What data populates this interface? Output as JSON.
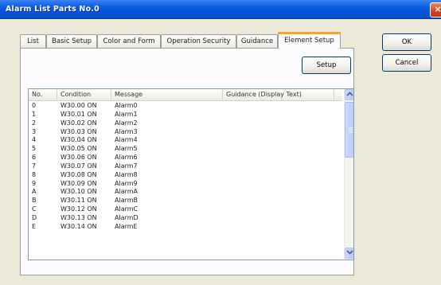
{
  "window": {
    "title": "Alarm List Parts No.0",
    "close_label": "×"
  },
  "tabs": [
    {
      "label": "List",
      "active": false
    },
    {
      "label": "Basic Setup",
      "active": false
    },
    {
      "label": "Color and Form",
      "active": false
    },
    {
      "label": "Operation Security",
      "active": false
    },
    {
      "label": "Guidance",
      "active": false
    },
    {
      "label": "Element Setup",
      "active": true
    }
  ],
  "buttons": {
    "setup_label": "Setup",
    "ok_label": "OK",
    "cancel_label": "Cancel"
  },
  "list": {
    "columns": [
      "No.",
      "Condition",
      "Message",
      "Guidance (Display Text)"
    ],
    "rows": [
      {
        "no": "0",
        "condition": "W30.00 ON",
        "message": "Alarm0",
        "guidance": ""
      },
      {
        "no": "1",
        "condition": "W30.01 ON",
        "message": "Alarm1",
        "guidance": ""
      },
      {
        "no": "2",
        "condition": "W30.02 ON",
        "message": "Alarm2",
        "guidance": ""
      },
      {
        "no": "3",
        "condition": "W30.03 ON",
        "message": "Alarm3",
        "guidance": ""
      },
      {
        "no": "4",
        "condition": "W30.04 ON",
        "message": "Alarm4",
        "guidance": ""
      },
      {
        "no": "5",
        "condition": "W30.05 ON",
        "message": "Alarm5",
        "guidance": ""
      },
      {
        "no": "6",
        "condition": "W30.06 ON",
        "message": "Alarm6",
        "guidance": ""
      },
      {
        "no": "7",
        "condition": "W30.07 ON",
        "message": "Alarm7",
        "guidance": ""
      },
      {
        "no": "8",
        "condition": "W30.08 ON",
        "message": "Alarm8",
        "guidance": ""
      },
      {
        "no": "9",
        "condition": "W30.09 ON",
        "message": "Alarm9",
        "guidance": ""
      },
      {
        "no": "A",
        "condition": "W30.10 ON",
        "message": "AlarmA",
        "guidance": ""
      },
      {
        "no": "B",
        "condition": "W30.11 ON",
        "message": "AlarmB",
        "guidance": ""
      },
      {
        "no": "C",
        "condition": "W30.12 ON",
        "message": "AlarmC",
        "guidance": ""
      },
      {
        "no": "D",
        "condition": "W30.13 ON",
        "message": "AlarmD",
        "guidance": ""
      },
      {
        "no": "E",
        "condition": "W30.14 ON",
        "message": "AlarmE",
        "guidance": ""
      }
    ]
  },
  "scrollbar": {
    "up_icon": "chevron-up-icon",
    "down_icon": "chevron-down-icon"
  }
}
